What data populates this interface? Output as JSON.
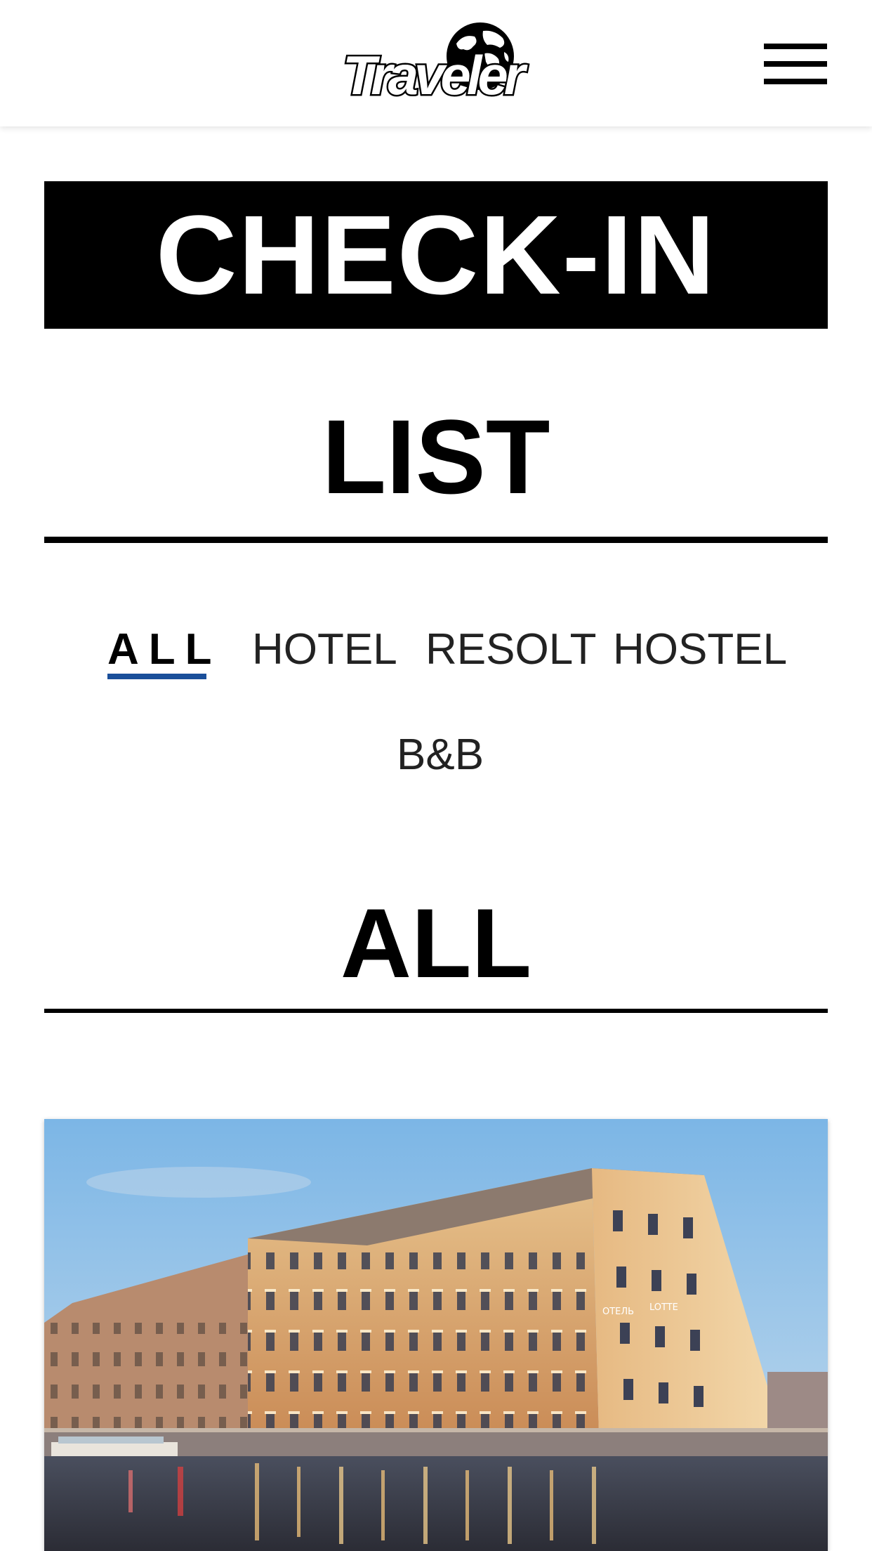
{
  "header": {
    "logo_text": "Traveler",
    "menu_icon": "hamburger-menu-icon"
  },
  "banner": {
    "title": "CHECK-IN"
  },
  "list_section": {
    "title": "LIST"
  },
  "filters": {
    "tabs": [
      {
        "label": "ALL",
        "active": true
      },
      {
        "label": "HOTEL",
        "active": false
      },
      {
        "label": "RESOLT",
        "active": false
      },
      {
        "label": "HOSTEL",
        "active": false
      },
      {
        "label": "B&B",
        "active": false
      }
    ],
    "active_color": "#1a4f9a"
  },
  "results_section": {
    "title": "ALL"
  },
  "cards": [
    {
      "image": "hotel-building-at-dusk-photo",
      "sign_left": "ОТЕЛЬ",
      "sign_right": "LOTTE"
    }
  ]
}
